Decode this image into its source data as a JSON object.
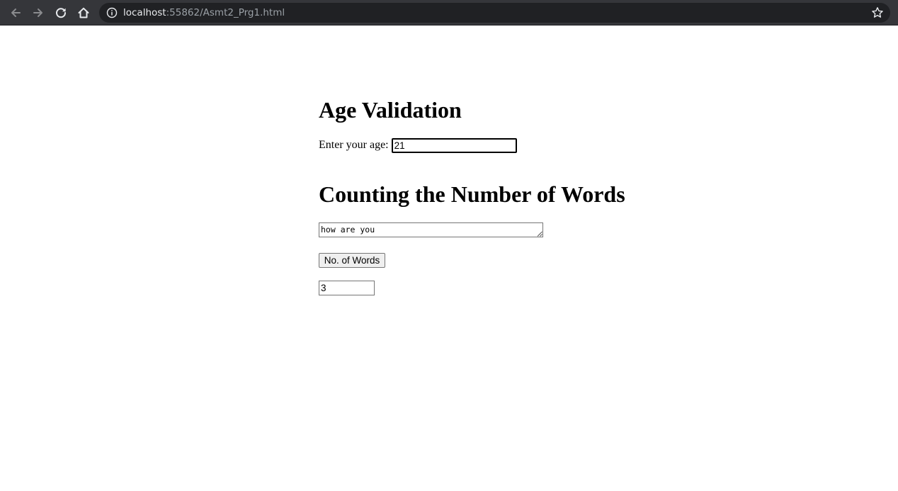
{
  "browser": {
    "url_host": "localhost",
    "url_rest": ":55862/Asmt2_Prg1.html",
    "icons": {
      "back": "back-arrow-icon",
      "forward": "forward-arrow-icon",
      "reload": "reload-icon",
      "home": "home-icon",
      "info": "info-icon",
      "bookmark": "star-icon"
    },
    "colors": {
      "toolbar": "#35363a",
      "omnibox": "#202124",
      "url_host": "#e8eaed",
      "url_rest": "#9aa0a6"
    }
  },
  "age_section": {
    "heading": "Age Validation",
    "label": "Enter your age:",
    "value": "21"
  },
  "words_section": {
    "heading": "Counting the Number of Words",
    "text": "how are you",
    "button_label": "No. of Words",
    "result": "3"
  }
}
